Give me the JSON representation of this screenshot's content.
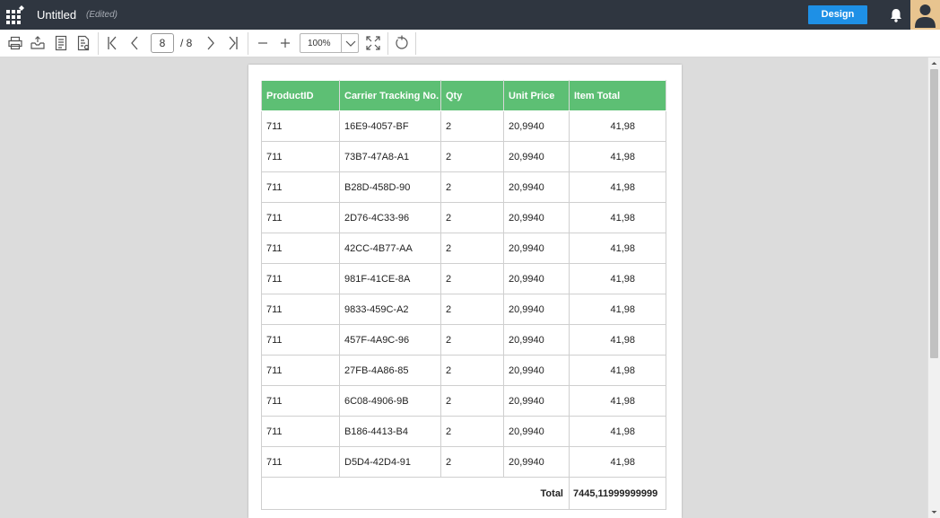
{
  "app": {
    "title": "Untitled",
    "status": "(Edited)",
    "design_button": "Design",
    "accent_color": "#1e90e6"
  },
  "icons": {
    "apps": "apps-grid-icon",
    "notifications": "bell-icon",
    "user": "user-avatar-icon",
    "print": "print-icon",
    "export": "export-icon",
    "page_setup": "page-setup-icon",
    "parameters": "parameters-icon",
    "first_page": "first-page-icon",
    "prev_page": "previous-page-icon",
    "next_page": "next-page-icon",
    "last_page": "last-page-icon",
    "zoom_out": "zoom-out-icon",
    "zoom_in": "zoom-in-icon",
    "fit_page": "fit-to-page-icon",
    "refresh": "refresh-icon"
  },
  "toolbar": {
    "current_page": "8",
    "total_pages": "/ 8",
    "zoom": "100%"
  },
  "report": {
    "header_color": "#5dbf74",
    "columns": [
      "ProductID",
      "Carrier Tracking No.",
      "Qty",
      "Unit Price",
      "Item Total"
    ],
    "rows": [
      [
        "711",
        "16E9-4057-BF",
        "2",
        "20,9940",
        "41,98"
      ],
      [
        "711",
        "73B7-47A8-A1",
        "2",
        "20,9940",
        "41,98"
      ],
      [
        "711",
        "B28D-458D-90",
        "2",
        "20,9940",
        "41,98"
      ],
      [
        "711",
        "2D76-4C33-96",
        "2",
        "20,9940",
        "41,98"
      ],
      [
        "711",
        "42CC-4B77-AA",
        "2",
        "20,9940",
        "41,98"
      ],
      [
        "711",
        "981F-41CE-8A",
        "2",
        "20,9940",
        "41,98"
      ],
      [
        "711",
        "9833-459C-A2",
        "2",
        "20,9940",
        "41,98"
      ],
      [
        "711",
        "457F-4A9C-96",
        "2",
        "20,9940",
        "41,98"
      ],
      [
        "711",
        "27FB-4A86-85",
        "2",
        "20,9940",
        "41,98"
      ],
      [
        "711",
        "6C08-4906-9B",
        "2",
        "20,9940",
        "41,98"
      ],
      [
        "711",
        "B186-4413-B4",
        "2",
        "20,9940",
        "41,98"
      ],
      [
        "711",
        "D5D4-42D4-91",
        "2",
        "20,9940",
        "41,98"
      ]
    ],
    "total_label": "Total",
    "total_value": "7445,11999999999"
  }
}
